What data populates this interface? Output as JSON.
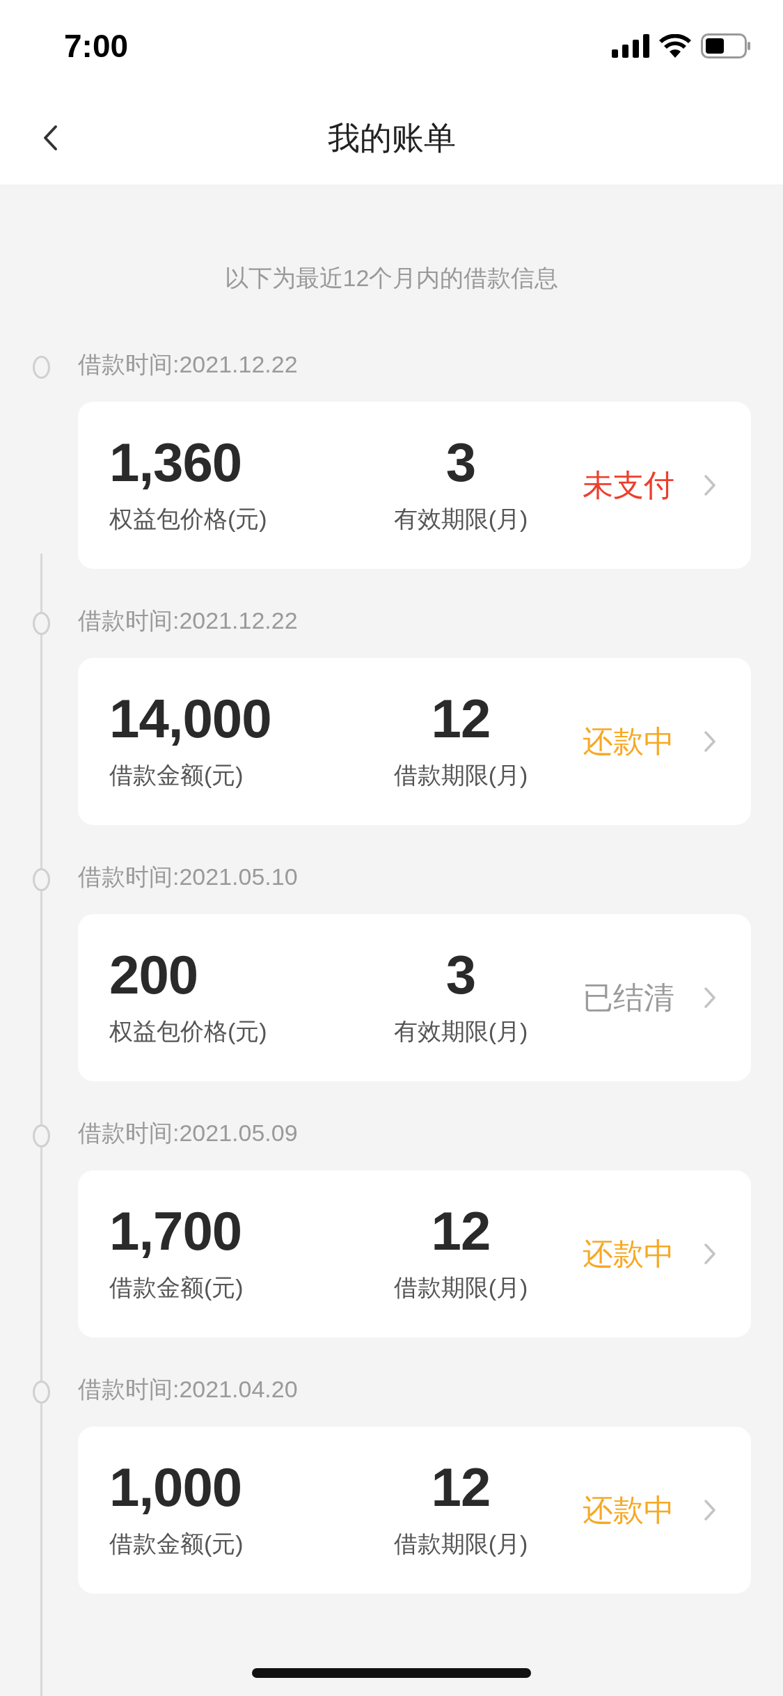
{
  "status_bar": {
    "time": "7:00"
  },
  "nav": {
    "title": "我的账单"
  },
  "notice": "以下为最近12个月内的借款信息",
  "bills": [
    {
      "date": "借款时间:2021.12.22",
      "amount": "1,360",
      "amount_label": "权益包价格(元)",
      "term": "3",
      "term_label": "有效期限(月)",
      "status": "未支付",
      "kind": "unpaid"
    },
    {
      "date": "借款时间:2021.12.22",
      "amount": "14,000",
      "amount_label": "借款金额(元)",
      "term": "12",
      "term_label": "借款期限(月)",
      "status": "还款中",
      "kind": "repaying"
    },
    {
      "date": "借款时间:2021.05.10",
      "amount": "200",
      "amount_label": "权益包价格(元)",
      "term": "3",
      "term_label": "有效期限(月)",
      "status": "已结清",
      "kind": "settled"
    },
    {
      "date": "借款时间:2021.05.09",
      "amount": "1,700",
      "amount_label": "借款金额(元)",
      "term": "12",
      "term_label": "借款期限(月)",
      "status": "还款中",
      "kind": "repaying"
    },
    {
      "date": "借款时间:2021.04.20",
      "amount": "1,000",
      "amount_label": "借款金额(元)",
      "term": "12",
      "term_label": "借款期限(月)",
      "status": "还款中",
      "kind": "repaying"
    }
  ]
}
